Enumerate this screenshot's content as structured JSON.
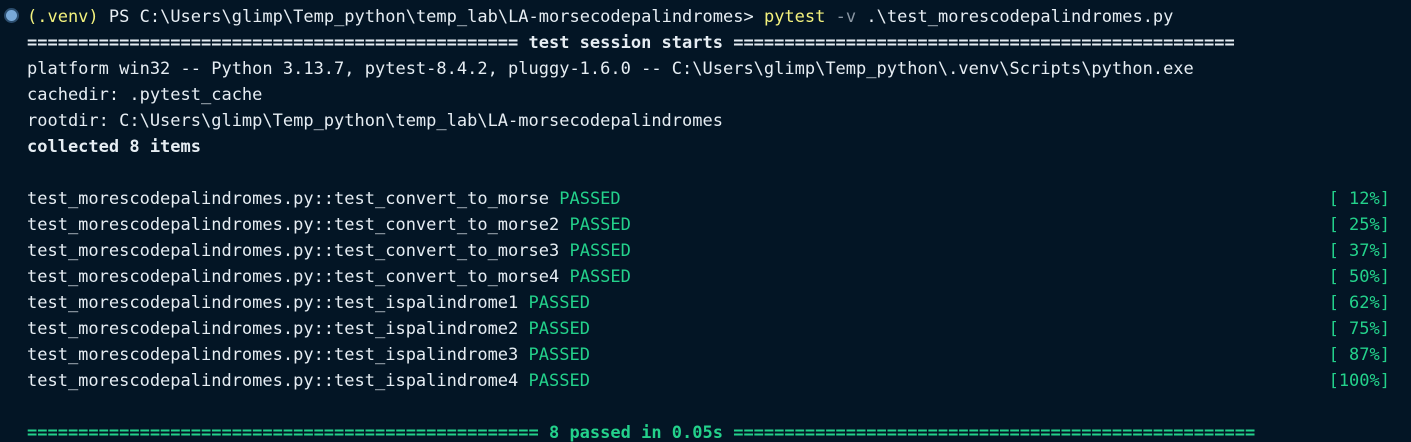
{
  "prompt": {
    "venv": "(.venv)",
    "ps_path": "PS C:\\Users\\glimp\\Temp_python\\temp_lab\\LA-morsecodepalindromes>",
    "command": "pytest",
    "flag": "-v",
    "target": ".\\test_morescodepalindromes.py"
  },
  "session_header": "================================================ test session starts =================================================",
  "info_lines": [
    "platform win32 -- Python 3.13.7, pytest-8.4.2, pluggy-1.6.0 -- C:\\Users\\glimp\\Temp_python\\.venv\\Scripts\\python.exe",
    "cachedir: .pytest_cache",
    "rootdir: C:\\Users\\glimp\\Temp_python\\temp_lab\\LA-morsecodepalindromes"
  ],
  "collected": "collected 8 items",
  "tests": [
    {
      "name": "test_morescodepalindromes.py::test_convert_to_morse",
      "status": "PASSED",
      "progress": "[ 12%]"
    },
    {
      "name": "test_morescodepalindromes.py::test_convert_to_morse2",
      "status": "PASSED",
      "progress": "[ 25%]"
    },
    {
      "name": "test_morescodepalindromes.py::test_convert_to_morse3",
      "status": "PASSED",
      "progress": "[ 37%]"
    },
    {
      "name": "test_morescodepalindromes.py::test_convert_to_morse4",
      "status": "PASSED",
      "progress": "[ 50%]"
    },
    {
      "name": "test_morescodepalindromes.py::test_ispalindrome1",
      "status": "PASSED",
      "progress": "[ 62%]"
    },
    {
      "name": "test_morescodepalindromes.py::test_ispalindrome2",
      "status": "PASSED",
      "progress": "[ 75%]"
    },
    {
      "name": "test_morescodepalindromes.py::test_ispalindrome3",
      "status": "PASSED",
      "progress": "[ 87%]"
    },
    {
      "name": "test_morescodepalindromes.py::test_ispalindrome4",
      "status": "PASSED",
      "progress": "[100%]"
    }
  ],
  "summary": "================================================== 8 passed in 0.05s ===================================================",
  "colors": {
    "background": "#031525",
    "text": "#e6edf3",
    "pass_green": "#23d18b",
    "command_yellow": "#f3f27d"
  }
}
